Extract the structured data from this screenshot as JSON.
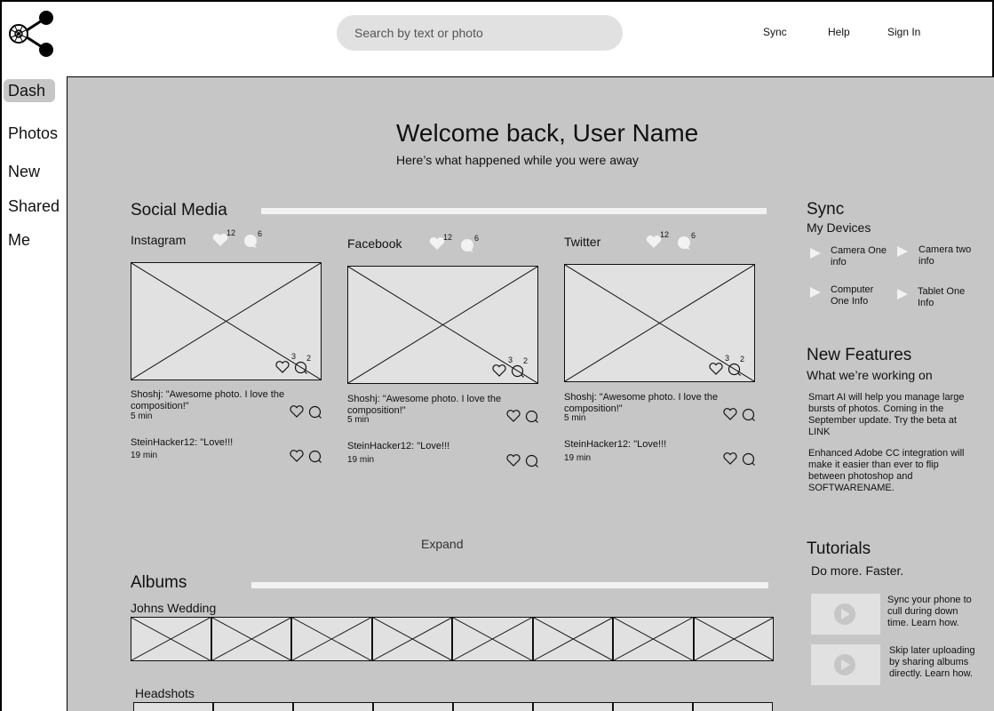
{
  "header": {
    "search_placeholder": "Search by text or photo",
    "links": [
      "Sync",
      "Help",
      "Sign In"
    ]
  },
  "sidebar": {
    "items": [
      "Dash",
      "Photos",
      "New",
      "Shared",
      "Me"
    ],
    "active": "Dash"
  },
  "welcome": {
    "title": "Welcome back, User Name",
    "subtitle": "Here’s what happened while you were away"
  },
  "social": {
    "title": "Social Media",
    "networks": [
      {
        "name": "Instagram",
        "likes": "12",
        "comments": "6",
        "photo_likes": "3",
        "photo_comments": "2",
        "comments_list": [
          {
            "text": "Shoshj: \"Awesome photo. I love the composition!\"",
            "time": "5 min"
          },
          {
            "text": "SteinHacker12: \"Love!!!",
            "time": "19 min"
          }
        ]
      },
      {
        "name": "Facebook",
        "likes": "12",
        "comments": "6",
        "photo_likes": "3",
        "photo_comments": "2",
        "comments_list": [
          {
            "text": "Shoshj: \"Awesome photo. I love the composition!\"",
            "time": "5 min"
          },
          {
            "text": "SteinHacker12: \"Love!!!",
            "time": "19 min"
          }
        ]
      },
      {
        "name": "Twitter",
        "likes": "12",
        "comments": "6",
        "photo_likes": "3",
        "photo_comments": "2",
        "comments_list": [
          {
            "text": "Shoshj: \"Awesome photo. I love the composition!\"",
            "time": "5 min"
          },
          {
            "text": "SteinHacker12: \"Love!!!",
            "time": "19 min"
          }
        ]
      }
    ],
    "expand_label": "Expand"
  },
  "albums": {
    "title": "Albums",
    "items": [
      "Johns Wedding",
      "Headshots"
    ]
  },
  "sync": {
    "title": "Sync",
    "subtitle": "My Devices",
    "devices": [
      "Camera One info",
      "Camera two info",
      "Computer One Info",
      "Tablet One Info"
    ]
  },
  "features": {
    "title": "New Features",
    "subtitle": "What we’re working on",
    "items": [
      "Smart AI will help you manage large bursts of photos. Coming in the September update. Try the beta at LINK",
      "Enhanced Adobe CC integration will make it easier than ever to flip between photoshop and SOFTWARENAME."
    ]
  },
  "tutorials": {
    "title": "Tutorials",
    "subtitle": "Do more. Faster.",
    "items": [
      "Sync your phone to cull during down time. Learn how.",
      "Skip later uploading by sharing albums directly. Learn how."
    ]
  },
  "icons": {
    "logo": "share-icon",
    "like": "heart-icon",
    "comment": "comment-bubble-icon",
    "device": "play-triangle-icon",
    "video": "play-button-icon"
  },
  "colors": {
    "panel": "#c6c6c6",
    "placeholder": "#e1e1e1",
    "rule": "#f2f2f2"
  }
}
